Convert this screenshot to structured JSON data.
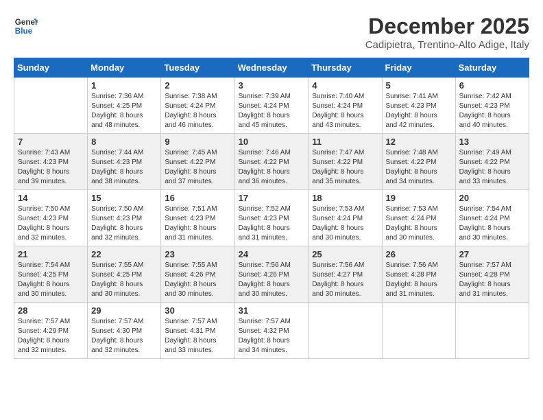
{
  "logo": {
    "line1": "General",
    "line2": "Blue"
  },
  "title": "December 2025",
  "location": "Cadipietra, Trentino-Alto Adige, Italy",
  "weekdays": [
    "Sunday",
    "Monday",
    "Tuesday",
    "Wednesday",
    "Thursday",
    "Friday",
    "Saturday"
  ],
  "weeks": [
    [
      {
        "day": "",
        "info": ""
      },
      {
        "day": "1",
        "info": "Sunrise: 7:36 AM\nSunset: 4:25 PM\nDaylight: 8 hours\nand 48 minutes."
      },
      {
        "day": "2",
        "info": "Sunrise: 7:38 AM\nSunset: 4:24 PM\nDaylight: 8 hours\nand 46 minutes."
      },
      {
        "day": "3",
        "info": "Sunrise: 7:39 AM\nSunset: 4:24 PM\nDaylight: 8 hours\nand 45 minutes."
      },
      {
        "day": "4",
        "info": "Sunrise: 7:40 AM\nSunset: 4:24 PM\nDaylight: 8 hours\nand 43 minutes."
      },
      {
        "day": "5",
        "info": "Sunrise: 7:41 AM\nSunset: 4:23 PM\nDaylight: 8 hours\nand 42 minutes."
      },
      {
        "day": "6",
        "info": "Sunrise: 7:42 AM\nSunset: 4:23 PM\nDaylight: 8 hours\nand 40 minutes."
      }
    ],
    [
      {
        "day": "7",
        "info": "Sunrise: 7:43 AM\nSunset: 4:23 PM\nDaylight: 8 hours\nand 39 minutes."
      },
      {
        "day": "8",
        "info": "Sunrise: 7:44 AM\nSunset: 4:23 PM\nDaylight: 8 hours\nand 38 minutes."
      },
      {
        "day": "9",
        "info": "Sunrise: 7:45 AM\nSunset: 4:22 PM\nDaylight: 8 hours\nand 37 minutes."
      },
      {
        "day": "10",
        "info": "Sunrise: 7:46 AM\nSunset: 4:22 PM\nDaylight: 8 hours\nand 36 minutes."
      },
      {
        "day": "11",
        "info": "Sunrise: 7:47 AM\nSunset: 4:22 PM\nDaylight: 8 hours\nand 35 minutes."
      },
      {
        "day": "12",
        "info": "Sunrise: 7:48 AM\nSunset: 4:22 PM\nDaylight: 8 hours\nand 34 minutes."
      },
      {
        "day": "13",
        "info": "Sunrise: 7:49 AM\nSunset: 4:22 PM\nDaylight: 8 hours\nand 33 minutes."
      }
    ],
    [
      {
        "day": "14",
        "info": "Sunrise: 7:50 AM\nSunset: 4:23 PM\nDaylight: 8 hours\nand 32 minutes."
      },
      {
        "day": "15",
        "info": "Sunrise: 7:50 AM\nSunset: 4:23 PM\nDaylight: 8 hours\nand 32 minutes."
      },
      {
        "day": "16",
        "info": "Sunrise: 7:51 AM\nSunset: 4:23 PM\nDaylight: 8 hours\nand 31 minutes."
      },
      {
        "day": "17",
        "info": "Sunrise: 7:52 AM\nSunset: 4:23 PM\nDaylight: 8 hours\nand 31 minutes."
      },
      {
        "day": "18",
        "info": "Sunrise: 7:53 AM\nSunset: 4:24 PM\nDaylight: 8 hours\nand 30 minutes."
      },
      {
        "day": "19",
        "info": "Sunrise: 7:53 AM\nSunset: 4:24 PM\nDaylight: 8 hours\nand 30 minutes."
      },
      {
        "day": "20",
        "info": "Sunrise: 7:54 AM\nSunset: 4:24 PM\nDaylight: 8 hours\nand 30 minutes."
      }
    ],
    [
      {
        "day": "21",
        "info": "Sunrise: 7:54 AM\nSunset: 4:25 PM\nDaylight: 8 hours\nand 30 minutes."
      },
      {
        "day": "22",
        "info": "Sunrise: 7:55 AM\nSunset: 4:25 PM\nDaylight: 8 hours\nand 30 minutes."
      },
      {
        "day": "23",
        "info": "Sunrise: 7:55 AM\nSunset: 4:26 PM\nDaylight: 8 hours\nand 30 minutes."
      },
      {
        "day": "24",
        "info": "Sunrise: 7:56 AM\nSunset: 4:26 PM\nDaylight: 8 hours\nand 30 minutes."
      },
      {
        "day": "25",
        "info": "Sunrise: 7:56 AM\nSunset: 4:27 PM\nDaylight: 8 hours\nand 30 minutes."
      },
      {
        "day": "26",
        "info": "Sunrise: 7:56 AM\nSunset: 4:28 PM\nDaylight: 8 hours\nand 31 minutes."
      },
      {
        "day": "27",
        "info": "Sunrise: 7:57 AM\nSunset: 4:28 PM\nDaylight: 8 hours\nand 31 minutes."
      }
    ],
    [
      {
        "day": "28",
        "info": "Sunrise: 7:57 AM\nSunset: 4:29 PM\nDaylight: 8 hours\nand 32 minutes."
      },
      {
        "day": "29",
        "info": "Sunrise: 7:57 AM\nSunset: 4:30 PM\nDaylight: 8 hours\nand 32 minutes."
      },
      {
        "day": "30",
        "info": "Sunrise: 7:57 AM\nSunset: 4:31 PM\nDaylight: 8 hours\nand 33 minutes."
      },
      {
        "day": "31",
        "info": "Sunrise: 7:57 AM\nSunset: 4:32 PM\nDaylight: 8 hours\nand 34 minutes."
      },
      {
        "day": "",
        "info": ""
      },
      {
        "day": "",
        "info": ""
      },
      {
        "day": "",
        "info": ""
      }
    ]
  ],
  "colors": {
    "header_bg": "#1a6bbf",
    "shaded_row": "#f0f0f0",
    "white_row": "#ffffff"
  }
}
